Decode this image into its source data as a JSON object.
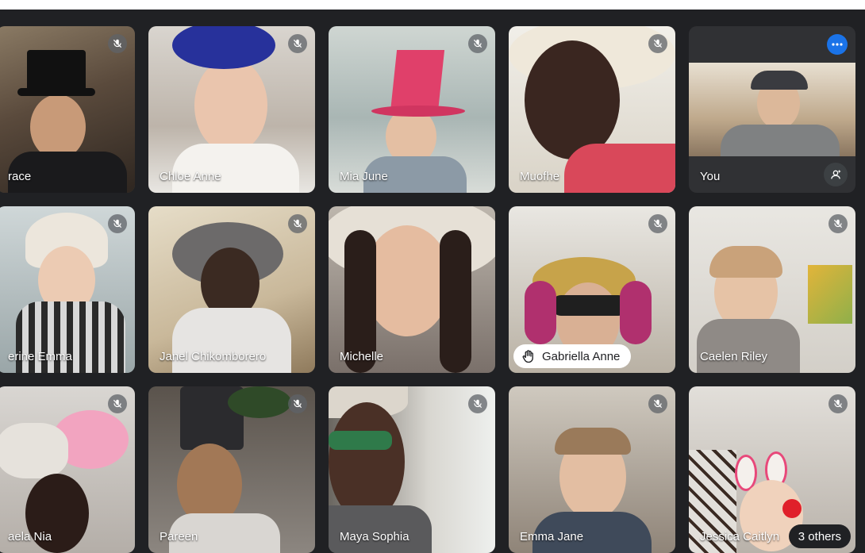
{
  "app": {
    "name": "Video meeting grid view"
  },
  "participants": [
    {
      "name": "Grace",
      "display": "race",
      "muted": true
    },
    {
      "name": "Chloe Anne",
      "display": "Chloe Anne",
      "muted": true
    },
    {
      "name": "Mia June",
      "display": "Mia June",
      "muted": true
    },
    {
      "name": "Muofhe",
      "display": "Muofhe",
      "muted": true
    },
    {
      "name": "You",
      "display": "You",
      "muted": false,
      "self": true
    },
    {
      "name": "Katherine Emma",
      "display": "erine Emma",
      "muted": true
    },
    {
      "name": "Janel Chikomborero",
      "display": "Janel Chikomborero",
      "muted": true
    },
    {
      "name": "Michelle",
      "display": "Michelle",
      "muted": false
    },
    {
      "name": "Gabriella Anne",
      "display": "Gabriella Anne",
      "muted": true,
      "hand_raised": true
    },
    {
      "name": "Caelen Riley",
      "display": "Caelen Riley",
      "muted": true
    },
    {
      "name": "Michaela Nia",
      "display": "aela Nia",
      "muted": true
    },
    {
      "name": "Pareen",
      "display": "Pareen",
      "muted": true
    },
    {
      "name": "Maya Sophia",
      "display": "Maya Sophia",
      "muted": true
    },
    {
      "name": "Emma Jane",
      "display": "Emma Jane",
      "muted": true
    },
    {
      "name": "Jessica Caitlyn",
      "display": "Jessica Caitlyn",
      "muted": true
    }
  ],
  "others_chip": {
    "label": "3 others"
  },
  "icons": {
    "mute": "mic-off-icon",
    "more": "more-options-icon",
    "hand": "raised-hand-icon",
    "self_options": "visual-effects-icon"
  },
  "colors": {
    "background": "#202124",
    "accent": "#1a73e8",
    "tile": "#3c4043"
  }
}
